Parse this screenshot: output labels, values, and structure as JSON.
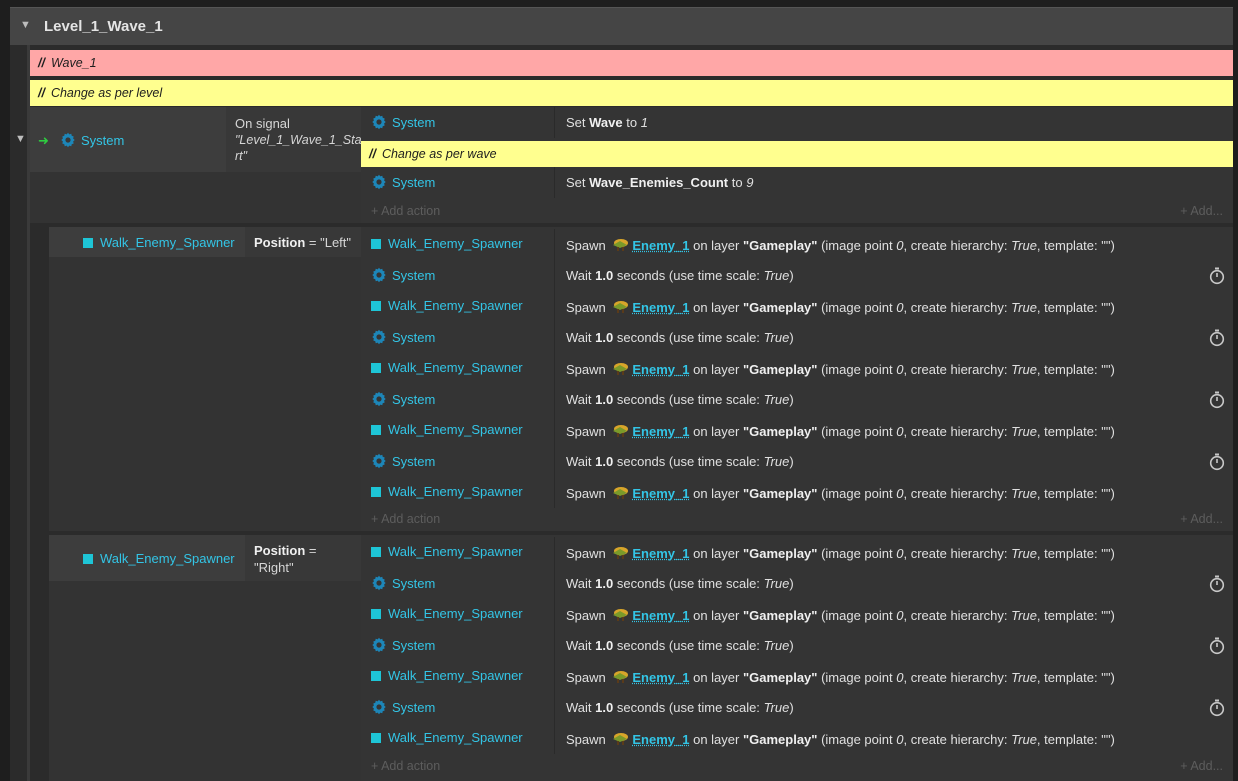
{
  "group": {
    "title": "Level_1_Wave_1"
  },
  "comments": {
    "wave": "Wave_1",
    "level": "Change as per level",
    "wave_change": "Change as per wave",
    "slashes": "//"
  },
  "icons": {
    "collapse": "triangle-down-icon",
    "trigger": "arrow-right-icon",
    "system": "gear-icon",
    "sprite": "cyan-square-icon",
    "enemy": "enemy-sprite-icon",
    "wait": "stopwatch-icon"
  },
  "colors": {
    "object": "#33c5e6",
    "comment_red": "#ffa7a7",
    "comment_yellow": "#ffff8f",
    "trigger_arrow": "#2ecc40"
  },
  "event1": {
    "trigger_object": "System",
    "cond_line1": "On signal",
    "cond_line2": "\"Level_1_Wave_1_Sta",
    "cond_line3": "rt\"",
    "a1_obj": "System",
    "a1_pre": "Set",
    "a1_var": "Wave",
    "a1_mid": "to",
    "a1_val": "1",
    "a2_obj": "System",
    "a2_pre": "Set",
    "a2_var": "Wave_Enemies_Count",
    "a2_mid": "to",
    "a2_val": "9",
    "add_action": "+ Add action",
    "add_more": "+ Add..."
  },
  "spawn": {
    "obj": "Walk_Enemy_Spawner",
    "verb": "Spawn",
    "enemy": "Enemy_1",
    "on_layer": "on layer",
    "layer": "\"Gameplay\"",
    "p1": "(image point",
    "p_val": "0",
    "p2": ", create hierarchy:",
    "p_true": "True",
    "p3": ", template:",
    "p_tpl": "\"\")"
  },
  "wait": {
    "obj": "System",
    "verb": "Wait",
    "secs": "1.0",
    "unit": "seconds (use time scale:",
    "scale": "True",
    "close": ")"
  },
  "event2": {
    "cond_object": "Walk_Enemy_Spawner",
    "cond_var": "Position",
    "cond_eq": "= \"Left\""
  },
  "event3": {
    "cond_object": "Walk_Enemy_Spawner",
    "cond_var": "Position",
    "cond_eq": "=",
    "cond_val": "\"Right\""
  },
  "add": {
    "action": "+ Add action",
    "more": "+ Add..."
  }
}
